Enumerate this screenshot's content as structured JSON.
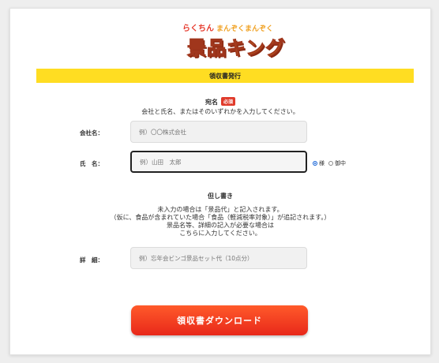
{
  "logo": {
    "small_text": "らくちん",
    "small_sub": "まんぞくまんぞく",
    "main_text": "景品キング"
  },
  "header_bar": {
    "title": "領収書発行"
  },
  "addressee": {
    "heading": "宛名",
    "required_badge": "必須",
    "note": "会社と氏名、またはそのいずれかを入力してください。"
  },
  "company_field": {
    "label": "会社名：",
    "placeholder": "例）〇〇株式会社",
    "value": ""
  },
  "name_field": {
    "label": "氏　名：",
    "placeholder": "例）山田　太郎",
    "value": ""
  },
  "honorific": {
    "options": [
      "様",
      "御中"
    ],
    "selected": "様"
  },
  "proviso": {
    "heading": "但し書き",
    "note_lines": [
      "未入力の場合は「景品代」と記入されます。",
      "（仮に、食品が含まれていた場合「食品（軽減税率対象）」が追記されます。）",
      "景品名等、詳細の記入が必要な場合は",
      "こちらに入力してください。"
    ]
  },
  "details_field": {
    "label": "詳　細：",
    "placeholder": "例）忘年会ビンゴ景品セット代（10点分）",
    "value": ""
  },
  "download_button": {
    "label": "領収書ダウンロード"
  },
  "colors": {
    "accent_bar": "#ffdd22",
    "button": "#f03a20",
    "required": "#e03a2a",
    "radio_selected": "#1a66d8"
  }
}
